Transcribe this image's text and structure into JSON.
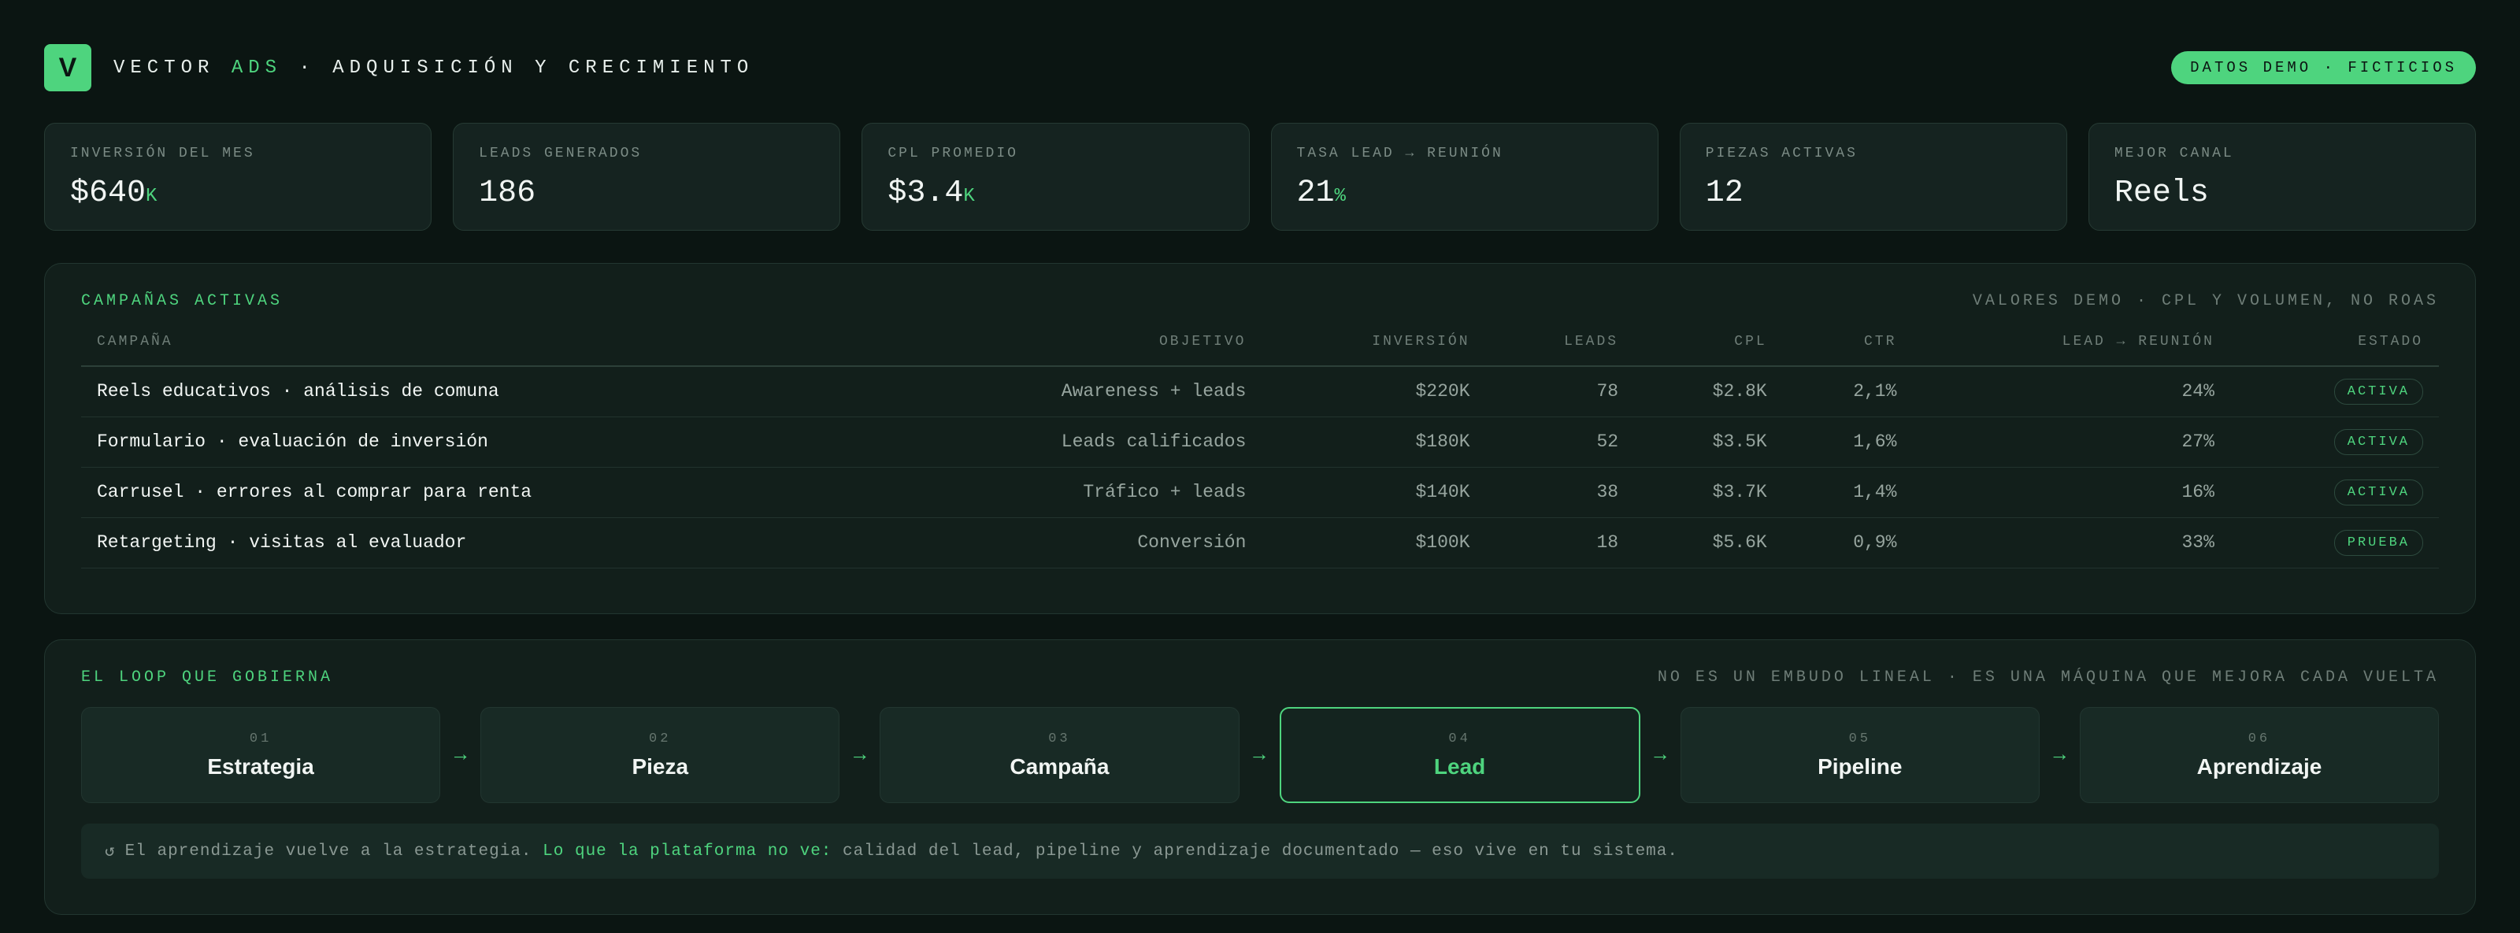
{
  "header": {
    "logo_letter": "V",
    "brand_prefix": "VECTOR ",
    "brand_accent": "ADS",
    "brand_suffix": " · ADQUISICIÓN Y CRECIMIENTO",
    "badge": "DATOS DEMO · FICTICIOS"
  },
  "kpis": [
    {
      "label": "INVERSIÓN DEL MES",
      "value": "$640",
      "unit": "K"
    },
    {
      "label": "LEADS GENERADOS",
      "value": "186",
      "unit": ""
    },
    {
      "label": "CPL PROMEDIO",
      "value": "$3.4",
      "unit": "K"
    },
    {
      "label": "TASA LEAD → REUNIÓN",
      "value": "21",
      "unit": "%"
    },
    {
      "label": "PIEZAS ACTIVAS",
      "value": "12",
      "unit": ""
    },
    {
      "label": "MEJOR CANAL",
      "value": "Reels",
      "unit": ""
    }
  ],
  "campaigns": {
    "title": "CAMPAÑAS ACTIVAS",
    "note": "VALORES DEMO · CPL Y VOLUMEN, NO ROAS",
    "columns": [
      "CAMPAÑA",
      "OBJETIVO",
      "INVERSIÓN",
      "LEADS",
      "CPL",
      "CTR",
      "LEAD → REUNIÓN",
      "ESTADO"
    ],
    "rows": [
      {
        "name": "Reels educativos · análisis de comuna",
        "objective": "Awareness + leads",
        "investment": "$220K",
        "leads": "78",
        "cpl": "$2.8K",
        "ctr": "2,1%",
        "meeting": "24%",
        "status": "ACTIVA"
      },
      {
        "name": "Formulario · evaluación de inversión",
        "objective": "Leads calificados",
        "investment": "$180K",
        "leads": "52",
        "cpl": "$3.5K",
        "ctr": "1,6%",
        "meeting": "27%",
        "status": "ACTIVA"
      },
      {
        "name": "Carrusel · errores al comprar para renta",
        "objective": "Tráfico + leads",
        "investment": "$140K",
        "leads": "38",
        "cpl": "$3.7K",
        "ctr": "1,4%",
        "meeting": "16%",
        "status": "ACTIVA"
      },
      {
        "name": "Retargeting · visitas al evaluador",
        "objective": "Conversión",
        "investment": "$100K",
        "leads": "18",
        "cpl": "$5.6K",
        "ctr": "0,9%",
        "meeting": "33%",
        "status": "PRUEBA"
      }
    ]
  },
  "loop": {
    "title": "EL LOOP QUE GOBIERNA",
    "note": "NO ES UN EMBUDO LINEAL · ES UNA MÁQUINA QUE MEJORA CADA VUELTA",
    "arrow": "→",
    "steps": [
      {
        "num": "01",
        "name": "Estrategia"
      },
      {
        "num": "02",
        "name": "Pieza"
      },
      {
        "num": "03",
        "name": "Campaña"
      },
      {
        "num": "04",
        "name": "Lead"
      },
      {
        "num": "05",
        "name": "Pipeline"
      },
      {
        "num": "06",
        "name": "Aprendizaje"
      }
    ],
    "active_step": 3,
    "footer_icon": "↺",
    "footer_text_1": "El aprendizaje vuelve a la estrategia.",
    "footer_highlight": "Lo que la plataforma no ve:",
    "footer_text_2": "calidad del lead, pipeline y aprendizaje documentado — eso vive en tu sistema."
  },
  "colors": {
    "background": "#0b1512",
    "accent": "#4ed47e",
    "card": "#152320"
  }
}
